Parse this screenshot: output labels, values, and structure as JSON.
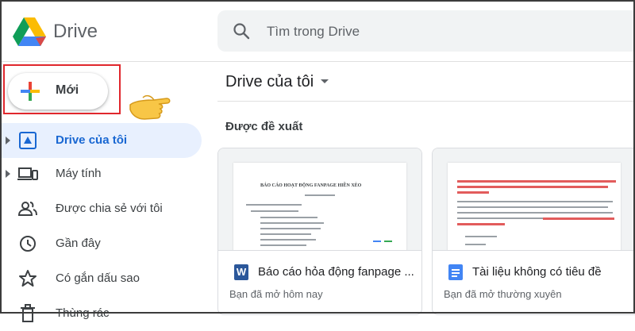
{
  "app": {
    "title": "Drive"
  },
  "search": {
    "placeholder": "Tìm trong Drive"
  },
  "new_button": {
    "label": "Mới"
  },
  "sidebar": {
    "items": [
      {
        "label": "Drive của tôi",
        "icon": "my-drive-icon",
        "active": true,
        "expandable": true
      },
      {
        "label": "Máy tính",
        "icon": "computer-icon",
        "expandable": true
      },
      {
        "label": "Được chia sẻ với tôi",
        "icon": "shared-people-icon"
      },
      {
        "label": "Gần đây",
        "icon": "clock-icon"
      },
      {
        "label": "Có gắn dấu sao",
        "icon": "star-icon"
      },
      {
        "label": "Thùng rác",
        "icon": "trash-icon"
      }
    ]
  },
  "main": {
    "title": "Drive của tôi",
    "section_label": "Được đề xuất",
    "cards": [
      {
        "name": "Báo cáo hỏa động fanpage ...",
        "subtitle": "Bạn đã mở hôm nay",
        "file_type": "word",
        "icon_letter": "W",
        "preview_title": "BÁO CÁO HOẠT ĐỘNG FANPAGE HIỀN XÈO"
      },
      {
        "name": "Tài liệu không có tiêu đề",
        "subtitle": "Bạn đã mở thường xuyên",
        "file_type": "docs"
      }
    ]
  },
  "colors": {
    "accent": "#1967d2",
    "active_bg": "#e8f0fe",
    "highlight": "#e0272d"
  }
}
